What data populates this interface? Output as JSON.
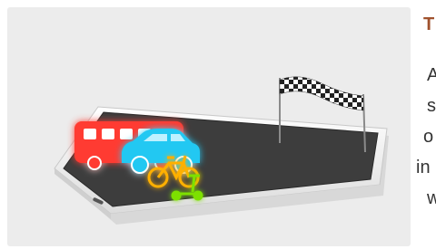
{
  "illustration": {
    "description_icons": [
      "bus-icon",
      "car-icon",
      "bicycle-icon",
      "scooter-icon",
      "checkered-flag-icon",
      "smartphone-icon"
    ],
    "colors": {
      "bus": "#ff3b30",
      "car": "#23c8f2",
      "bicycle": "#ffb000",
      "scooter": "#7de000",
      "phone_screen": "#3d3d3d",
      "phone_body": "#f5f5f5",
      "background": "#ececec"
    }
  },
  "side_text": {
    "heading_fragment": "T",
    "line_fragments": [
      "A",
      "s",
      "o",
      "in",
      "w"
    ]
  }
}
